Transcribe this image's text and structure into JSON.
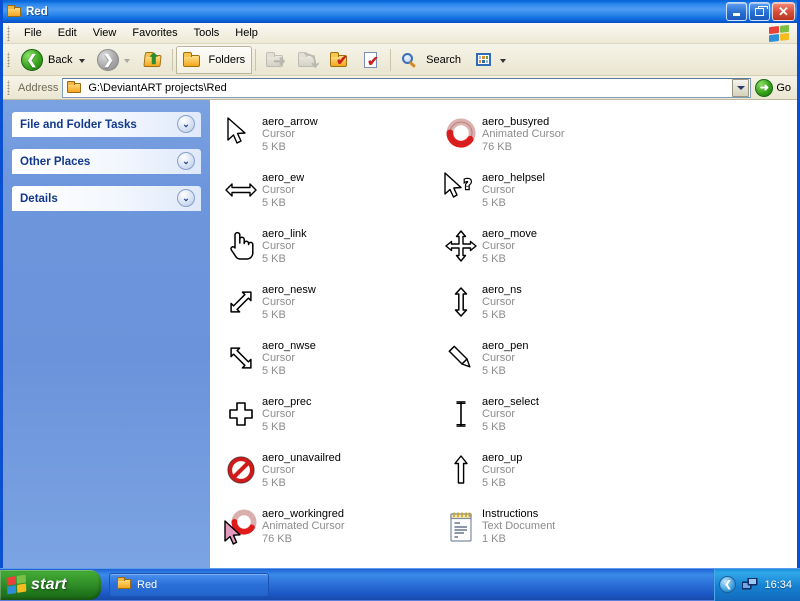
{
  "window": {
    "title": "Red",
    "title_icon": "folder-icon",
    "controls": {
      "minimize": "Minimize",
      "maximize": "Restore Down",
      "close": "Close"
    }
  },
  "menubar": {
    "items": [
      {
        "label": "File"
      },
      {
        "label": "Edit"
      },
      {
        "label": "View"
      },
      {
        "label": "Favorites"
      },
      {
        "label": "Tools"
      },
      {
        "label": "Help"
      }
    ],
    "logo_icon": "windows-flag-icon"
  },
  "toolbar": {
    "back": {
      "label": "Back",
      "icon": "back-arrow-icon"
    },
    "forward": {
      "label": "",
      "icon": "forward-arrow-icon"
    },
    "up": {
      "label": "",
      "icon": "up-folder-icon"
    },
    "folders": {
      "label": "Folders",
      "icon": "folders-icon"
    },
    "move_to": {
      "label": "",
      "icon": "move-to-folder-icon"
    },
    "copy_to": {
      "label": "",
      "icon": "copy-to-folder-icon"
    },
    "delete": {
      "label": "",
      "icon": "folder-check-icon"
    },
    "properties": {
      "label": "",
      "icon": "document-check-icon"
    },
    "search": {
      "label": "Search",
      "icon": "magnifier-icon"
    },
    "views": {
      "label": "",
      "icon": "views-grid-icon"
    }
  },
  "address": {
    "label": "Address",
    "path": "G:\\DeviantART projects\\Red",
    "folder_icon": "folder-icon",
    "dropdown_icon": "chevron-down-icon",
    "go_label": "Go",
    "go_icon": "go-arrow-icon"
  },
  "sidebar": {
    "panels": [
      {
        "title": "File and Folder Tasks",
        "chevron_icon": "chevron-double-down-icon"
      },
      {
        "title": "Other Places",
        "chevron_icon": "chevron-double-down-icon"
      },
      {
        "title": "Details",
        "chevron_icon": "chevron-double-down-icon"
      }
    ]
  },
  "files": [
    {
      "name": "aero_arrow",
      "type": "Cursor",
      "size": "5 KB",
      "icon": "cursor-arrow-icon"
    },
    {
      "name": "aero_busyred",
      "type": "Animated Cursor",
      "size": "76 KB",
      "icon": "cursor-busy-ring-icon"
    },
    {
      "name": "aero_ew",
      "type": "Cursor",
      "size": "5 KB",
      "icon": "cursor-resize-ew-icon"
    },
    {
      "name": "aero_helpsel",
      "type": "Cursor",
      "size": "5 KB",
      "icon": "cursor-help-select-icon"
    },
    {
      "name": "aero_link",
      "type": "Cursor",
      "size": "5 KB",
      "icon": "cursor-hand-link-icon"
    },
    {
      "name": "aero_move",
      "type": "Cursor",
      "size": "5 KB",
      "icon": "cursor-move-icon"
    },
    {
      "name": "aero_nesw",
      "type": "Cursor",
      "size": "5 KB",
      "icon": "cursor-resize-nesw-icon"
    },
    {
      "name": "aero_ns",
      "type": "Cursor",
      "size": "5 KB",
      "icon": "cursor-resize-ns-icon"
    },
    {
      "name": "aero_nwse",
      "type": "Cursor",
      "size": "5 KB",
      "icon": "cursor-resize-nwse-icon"
    },
    {
      "name": "aero_pen",
      "type": "Cursor",
      "size": "5 KB",
      "icon": "cursor-pen-icon"
    },
    {
      "name": "aero_prec",
      "type": "Cursor",
      "size": "5 KB",
      "icon": "cursor-precision-cross-icon"
    },
    {
      "name": "aero_select",
      "type": "Cursor",
      "size": "5 KB",
      "icon": "cursor-text-beam-icon"
    },
    {
      "name": "aero_unavailred",
      "type": "Cursor",
      "size": "5 KB",
      "icon": "cursor-unavailable-icon"
    },
    {
      "name": "aero_up",
      "type": "Cursor",
      "size": "5 KB",
      "icon": "cursor-up-arrow-icon"
    },
    {
      "name": "aero_workingred",
      "type": "Animated Cursor",
      "size": "76 KB",
      "icon": "cursor-working-icon"
    },
    {
      "name": "Instructions",
      "type": "Text Document",
      "size": "1 KB",
      "icon": "text-document-icon"
    }
  ],
  "taskbar": {
    "start_label": "start",
    "start_icon": "windows-flag-icon",
    "tasks": [
      {
        "label": "Red",
        "icon": "folder-icon"
      }
    ],
    "tray": {
      "collapse_icon": "chevron-left-icon",
      "network_icon": "network-connection-icon",
      "clock": "16:34"
    }
  },
  "colors": {
    "title_blue": "#0a62d4",
    "sidebar_blue": "#6d96dd",
    "accent_green": "#3aa520",
    "close_red": "#d9503c",
    "panel_text": "#13398c"
  }
}
